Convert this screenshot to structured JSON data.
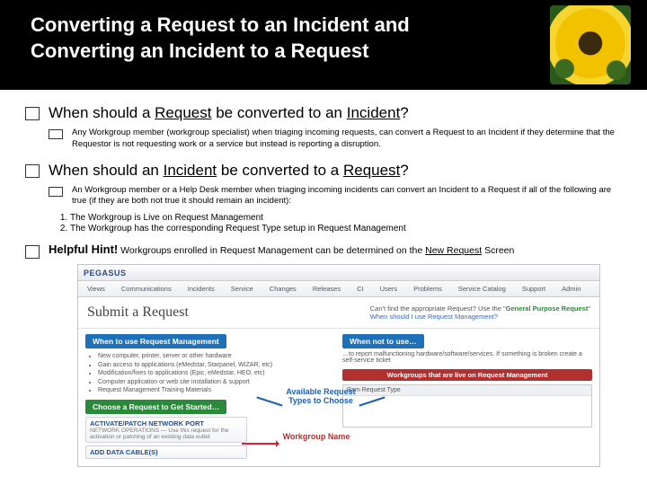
{
  "header": {
    "title_l1": "Converting a Request to an Incident and",
    "title_l2": "Converting an Incident to a Request"
  },
  "section1": {
    "heading_pre": "When should a ",
    "heading_u1": "Request",
    "heading_mid": " be converted to an ",
    "heading_u2": "Incident",
    "heading_post": "?",
    "note": "Any Workgroup member (workgroup specialist) when triaging incoming requests, can convert a Request to an Incident if they determine that the Requestor is not requesting work or a service but instead is reporting a disruption."
  },
  "section2": {
    "heading_pre": "When should an ",
    "heading_u1": "Incident",
    "heading_mid": " be converted to a ",
    "heading_u2": "Request",
    "heading_post": "?",
    "note": "An Workgroup member or a Help Desk member when triaging incoming incidents can convert an Incident to a Request if all of the following are true (if they are both not true it should remain an incident):",
    "ol1": "The Workgroup is Live on Request Management",
    "ol2": "The Workgroup has the corresponding Request Type setup in Request Management"
  },
  "hint": {
    "label": "Helpful Hint!",
    "text_pre": " Workgroups enrolled in Request Management can be determined on the ",
    "text_u": "New Request",
    "text_post": " Screen"
  },
  "screenshot": {
    "brand": "PEGASUS",
    "nav": [
      "Views",
      "Communications",
      "Incidents",
      "Service",
      "Changes",
      "Releases",
      "CI",
      "Users",
      "Problems",
      "Service Catalog",
      "Support",
      "Admin"
    ],
    "title": "Submit a Request",
    "tipline1_pre": "Can't find the appropriate Request? Use the \"",
    "tipline1_green": "General Purpose Request",
    "tipline1_post": "\"",
    "tipline2": "When should I use Request Management?",
    "whenUse": "When to use Request Management",
    "whenNot": "When not to use…",
    "bullets_left": [
      "New computer, printer, server or other hardware",
      "Gain access to applications (eMedstar, Starpanel, WIZAR, etc)",
      "Modification/fixes to applications (Epic, eMedstar, HEO, etc)",
      "Computer application or web site installation & support",
      "Request Management Training Materials"
    ],
    "whennot_line": "…to report malfunctioning hardware/software/services. If something is broken create a self-service ticket",
    "redtab": "Workgroups that are live on Request Management",
    "greentab": "Choose a Request to Get Started…",
    "wg_col": "Ram Request Type",
    "item1_title": "ACTIVATE/PATCH NETWORK PORT",
    "item1_sub": "NETWORK OPERATIONS — Use this request for the activation or patching of an existing data outlet",
    "item2_title": "ADD DATA CABLE(S)",
    "callout1": "Available Request Types to Choose",
    "callout2": "Workgroup Name"
  }
}
